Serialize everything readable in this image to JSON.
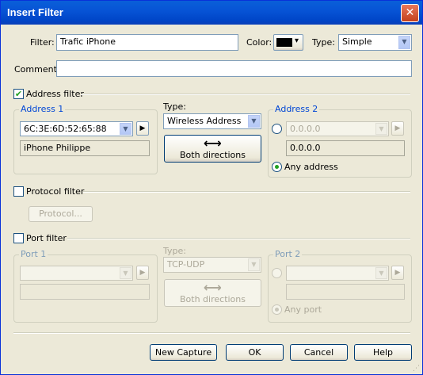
{
  "window": {
    "title": "Insert Filter",
    "close": "✕"
  },
  "filter": {
    "label": "Filter:",
    "value": "Trafic iPhone"
  },
  "color": {
    "label": "Color:",
    "swatch": "#000000",
    "arrow": "▾"
  },
  "type": {
    "label": "Type:",
    "value": "Simple"
  },
  "comment": {
    "label": "Comment:",
    "value": ""
  },
  "address": {
    "checkbox_label": "Address filter",
    "checked": true,
    "address1": {
      "title": "Address 1",
      "value": "6C:3E:6D:52:65:88",
      "alias": "iPhone Philippe"
    },
    "type_label": "Type:",
    "type_value": "Wireless Address",
    "direction_label": "Both directions",
    "address2": {
      "title": "Address 2",
      "value": "0.0.0.0",
      "field": "0.0.0.0",
      "any_label": "Any address"
    }
  },
  "protocol": {
    "checkbox_label": "Protocol filter",
    "checked": false,
    "button": "Protocol..."
  },
  "port": {
    "checkbox_label": "Port filter",
    "checked": false,
    "port1": {
      "title": "Port 1"
    },
    "type_label": "Type:",
    "type_value": "TCP-UDP",
    "direction_label": "Both directions",
    "port2": {
      "title": "Port 2",
      "any_label": "Any port"
    }
  },
  "buttons": {
    "new_capture": "New Capture",
    "ok": "OK",
    "cancel": "Cancel",
    "help": "Help"
  },
  "icons": {
    "play": "▶",
    "arrows": "⟷",
    "dropdown": "▼",
    "check": "✔"
  }
}
